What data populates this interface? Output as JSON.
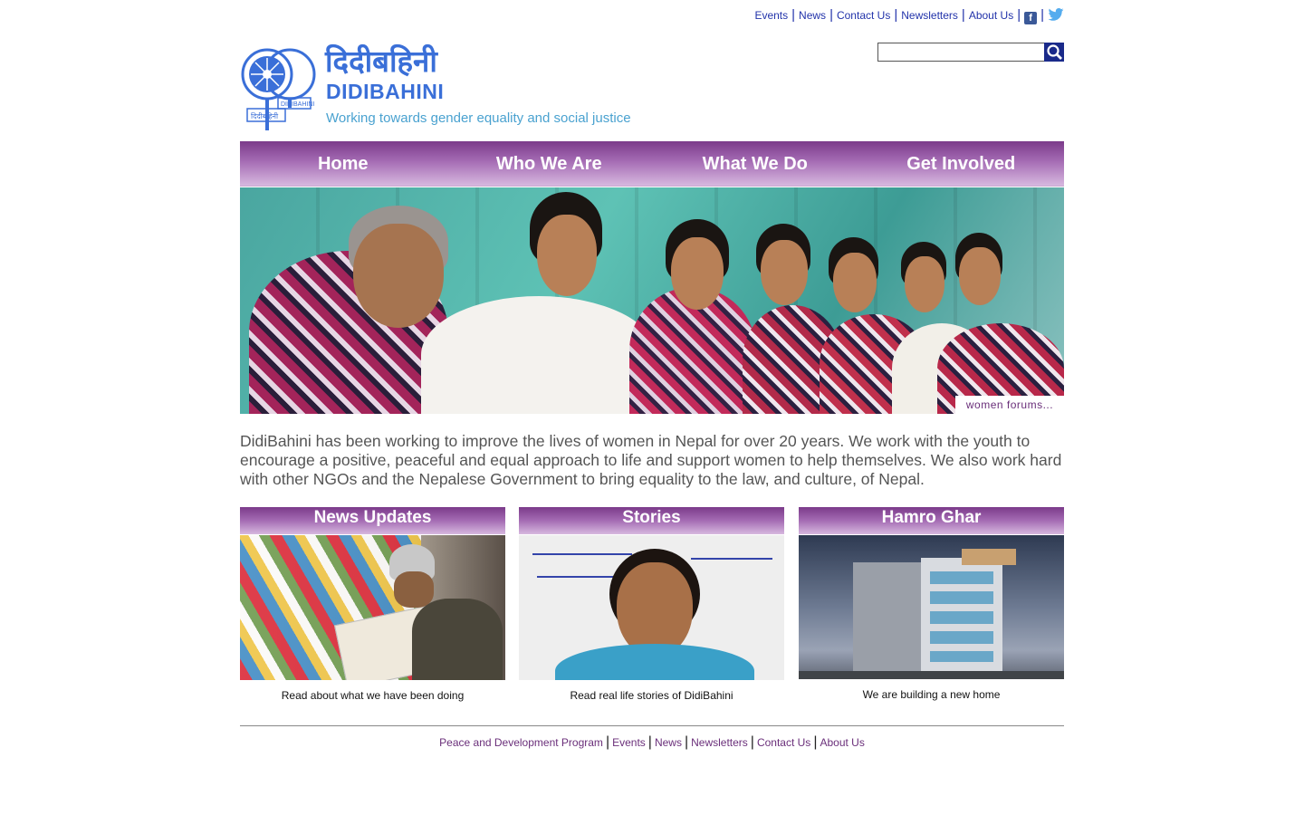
{
  "top_nav": {
    "items": [
      "Events",
      "News",
      "Contact Us",
      "Newsletters",
      "About Us"
    ]
  },
  "header": {
    "logo_devanagari": "दिदीबहिनी",
    "logo_name": "DIDIBAHINI",
    "tagline": "Working towards gender equality and social justice"
  },
  "search": {
    "placeholder": ""
  },
  "main_nav": [
    "Home",
    "Who We Are",
    "What We Do",
    "Get Involved"
  ],
  "hero": {
    "caption": "women forums..."
  },
  "intro": "DidiBahini has been working to improve the lives of women in Nepal for over 20 years. We work with the youth to encourage a positive, peaceful and equal approach to life and support women to help themselves. We also work hard with other NGOs and the Nepalese Government to bring equality to the law, and culture, of Nepal.",
  "boxes": [
    {
      "title": "News Updates",
      "caption": "Read about what we have been doing"
    },
    {
      "title": "Stories",
      "caption": "Read real life stories of DidiBahini"
    },
    {
      "title": "Hamro Ghar",
      "caption": "We are building a new home"
    }
  ],
  "footer": {
    "items": [
      "Peace and Development Program",
      "Events",
      "News",
      "Newsletters",
      "Contact Us",
      "About Us"
    ]
  },
  "colors": {
    "nav_purple": "#7b3a8a",
    "link_blue": "#2233aa",
    "footer_link": "#6a2f7a"
  },
  "icons": [
    "facebook-icon",
    "twitter-icon",
    "search-icon"
  ]
}
